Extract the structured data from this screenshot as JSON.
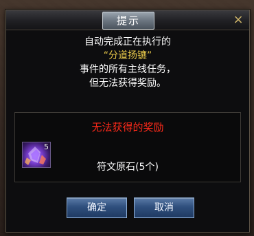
{
  "dialog": {
    "title": "提示",
    "close_icon": "×",
    "message": {
      "line1": "自动完成正在执行的",
      "event_name": "“分道扬镳”",
      "line3": "事件的所有主线任务，",
      "line4": "但无法获得奖励。"
    },
    "reward": {
      "title": "无法获得的奖励",
      "item": {
        "icon": "rune-stone-icon",
        "count": "5",
        "name": "符文原石(5个)"
      }
    },
    "buttons": {
      "confirm": "确定",
      "cancel": "取消"
    }
  },
  "colors": {
    "title_plate": "#6b7580",
    "event_name": "#e9c94a",
    "reward_title": "#ff2a1a",
    "button": "#2f4f7d"
  }
}
